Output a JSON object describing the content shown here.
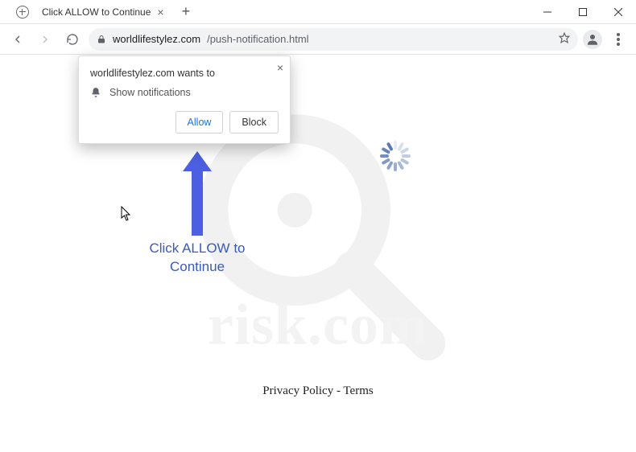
{
  "tab": {
    "title": "Click ALLOW to Continue"
  },
  "url": {
    "host": "worldlifestylez.com",
    "path": "/push-notification.html"
  },
  "permission": {
    "prompt": "worldlifestylez.com wants to",
    "capability": "Show notifications",
    "allow": "Allow",
    "block": "Block"
  },
  "page": {
    "cta_line1": "Click ALLOW to",
    "cta_line2": "Continue",
    "footer": "Privacy Policy - Terms"
  },
  "watermark": {
    "text": "risk.com"
  }
}
